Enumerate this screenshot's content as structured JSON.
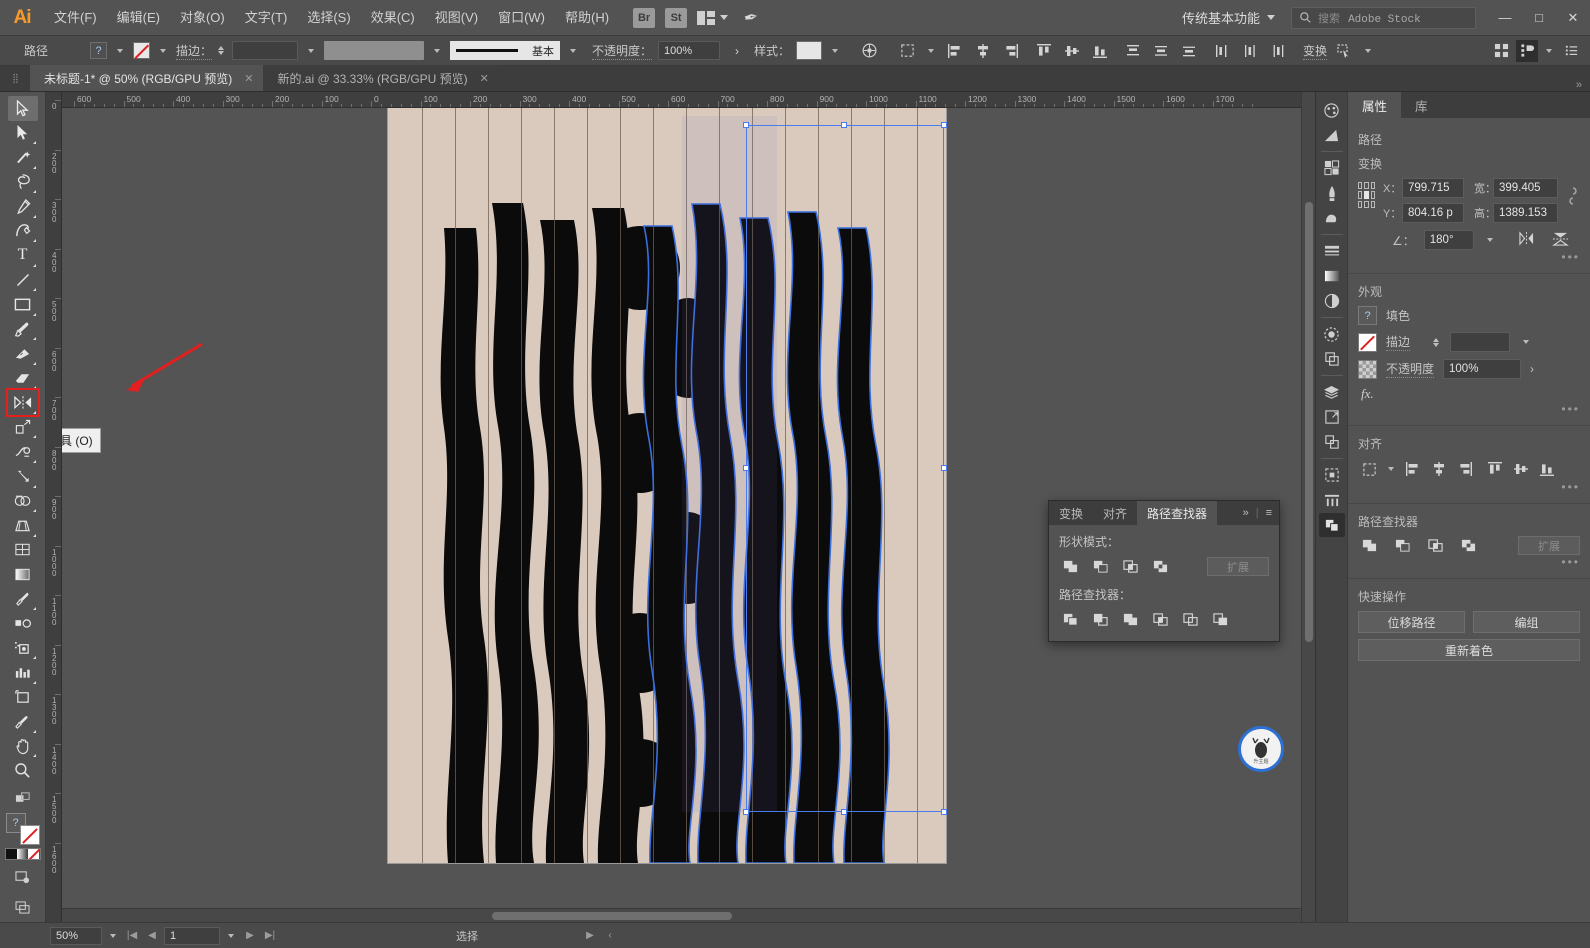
{
  "app": {
    "logo": "Ai"
  },
  "menubar": {
    "items": [
      {
        "label": "文件(F)"
      },
      {
        "label": "编辑(E)"
      },
      {
        "label": "对象(O)"
      },
      {
        "label": "文字(T)"
      },
      {
        "label": "选择(S)"
      },
      {
        "label": "效果(C)"
      },
      {
        "label": "视图(V)"
      },
      {
        "label": "窗口(W)"
      },
      {
        "label": "帮助(H)"
      }
    ],
    "bridge_button": "Br",
    "stock_button": "St",
    "workspace": "传统基本功能",
    "search_placeholder_prefix": "搜索",
    "search_placeholder_brand": "Adobe Stock",
    "window_minimize": "—",
    "window_maximize": "□",
    "window_close": "✕"
  },
  "controlbar": {
    "object_type": "路径",
    "fill_swatch_label": "?",
    "stroke_label": "描边：",
    "stroke_width": "",
    "stroke_profile": "基本",
    "opacity_label": "不透明度：",
    "opacity_value": "100%",
    "style_label": "样式：",
    "transform_label": "变换"
  },
  "tabs": {
    "documents": [
      {
        "title": "未标题-1* @ 50% (RGB/GPU 预览)",
        "active": true,
        "close": "✕"
      },
      {
        "title": "新的.ai @ 33.33% (RGB/GPU 预览)",
        "active": false,
        "close": "✕"
      }
    ]
  },
  "toolbar": {
    "tools": [
      {
        "name": "selection-tool",
        "selected": true
      },
      {
        "name": "direct-selection-tool"
      },
      {
        "name": "magic-wand-tool"
      },
      {
        "name": "lasso-tool"
      },
      {
        "name": "pen-tool"
      },
      {
        "name": "curvature-tool"
      },
      {
        "name": "type-tool"
      },
      {
        "name": "line-segment-tool"
      },
      {
        "name": "rectangle-tool"
      },
      {
        "name": "paintbrush-tool"
      },
      {
        "name": "shaper-tool"
      },
      {
        "name": "eraser-tool"
      },
      {
        "name": "reflect-tool",
        "highlighted": true
      },
      {
        "name": "scale-tool"
      },
      {
        "name": "width-tool"
      },
      {
        "name": "free-transform-tool"
      },
      {
        "name": "shape-builder-tool"
      },
      {
        "name": "perspective-grid-tool"
      },
      {
        "name": "mesh-tool"
      },
      {
        "name": "gradient-tool"
      },
      {
        "name": "eyedropper-tool"
      },
      {
        "name": "blend-tool"
      },
      {
        "name": "symbol-sprayer-tool"
      },
      {
        "name": "column-graph-tool"
      },
      {
        "name": "artboard-tool"
      },
      {
        "name": "slice-tool"
      },
      {
        "name": "hand-tool"
      },
      {
        "name": "zoom-tool"
      }
    ],
    "tooltip": "镜像工具 (O)"
  },
  "rulers": {
    "horizontal_ticks": [
      "600",
      "500",
      "400",
      "300",
      "200",
      "100",
      "0",
      "100",
      "200",
      "300",
      "400",
      "500",
      "600",
      "700",
      "800",
      "900",
      "1000",
      "1100",
      "1200",
      "1300",
      "1400",
      "1500",
      "1600",
      "1700"
    ],
    "vertical_ticks": [
      "0",
      "200",
      "300",
      "400",
      "500",
      "600",
      "700",
      "800",
      "900",
      "1000",
      "1100",
      "1200",
      "1300",
      "1400",
      "1500",
      "1600"
    ]
  },
  "pathfinder_panel": {
    "tabs": [
      {
        "label": "变换",
        "active": false
      },
      {
        "label": "对齐",
        "active": false
      },
      {
        "label": "路径查找器",
        "active": true
      }
    ],
    "collapse": "»",
    "menu": "≡",
    "shape_modes_label": "形状模式：",
    "expand_button": "扩展",
    "pathfinder_label": "路径查找器：",
    "shape_mode_icons": [
      "unite-icon",
      "minus-front-icon",
      "intersect-icon",
      "exclude-icon"
    ],
    "pathfinder_icons": [
      "divide-icon",
      "trim-icon",
      "merge-icon",
      "crop-icon",
      "outline-icon",
      "minus-back-icon"
    ]
  },
  "properties": {
    "tabs": [
      {
        "label": "属性",
        "active": true
      },
      {
        "label": "库",
        "active": false
      }
    ],
    "object_type": "路径",
    "transform": {
      "title": "变换",
      "x_label": "X：",
      "x_value": "799.715",
      "y_label": "Y：",
      "y_value": "804.16 p",
      "w_label": "宽：",
      "w_value": "399.405",
      "h_label": "高：",
      "h_value": "1389.153",
      "angle_label": "∠：",
      "angle_value": "180°",
      "more": "•••"
    },
    "appearance": {
      "title": "外观",
      "fill_label": "填色",
      "fill_swatch": "?",
      "stroke_label": "描边",
      "stroke_value": "",
      "opacity_label": "不透明度",
      "opacity_value": "100%",
      "fx_label": "fx.",
      "more": "•••"
    },
    "align": {
      "title": "对齐",
      "more": "•••"
    },
    "pathfinder": {
      "title": "路径查找器",
      "expand_button": "扩展",
      "more": "•••"
    },
    "quick_actions": {
      "title": "快速操作",
      "offset_path": "位移路径",
      "group": "编组",
      "recolor": "重新着色"
    }
  },
  "statusbar": {
    "zoom": "50%",
    "page": "1",
    "tool_status": "选择"
  },
  "artwork": {
    "background_color": "#d9cabd",
    "shape_color": "#0b0b0b",
    "selection_color": "#4a7cf0",
    "badge_text": "升主题"
  }
}
